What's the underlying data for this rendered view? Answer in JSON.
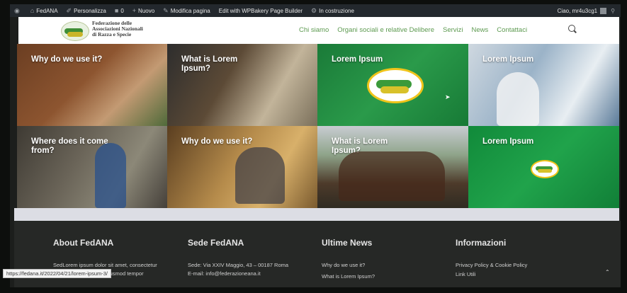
{
  "adminbar": {
    "items": [
      "FedANA",
      "Personalizza",
      "0",
      "Nuovo",
      "Modifica pagina",
      "Edit with WPBakery Page Builder",
      "In costruzione"
    ],
    "greeting": "Ciao, mr4u3cg1"
  },
  "header": {
    "org_line1": "Federazione delle",
    "org_line2": "Associazioni Nazionali",
    "org_line3": "di Razza e Specie",
    "nav": [
      "Chi siamo",
      "Organi sociali e relative Delibere",
      "Servizi",
      "News",
      "Contattaci"
    ]
  },
  "tiles": [
    {
      "title": "Why do we use it?"
    },
    {
      "title": "What is Lorem Ipsum?"
    },
    {
      "title": "Lorem Ipsum"
    },
    {
      "title": "Lorem Ipsum"
    },
    {
      "title": "Where does it come from?"
    },
    {
      "title": "Why do we use it?"
    },
    {
      "title": "What is Lorem Ipsum?"
    },
    {
      "title": "Lorem Ipsum"
    }
  ],
  "footer": {
    "about": {
      "title": "About FedANA",
      "text1": "SedLorem ipsum dolor sit amet, consectetur",
      "text2": "adipiscing elit, sed do eiusmod tempor"
    },
    "sede": {
      "title": "Sede FedANA",
      "address": "Sede: Via XXIV Maggio, 43 – 00187 Roma",
      "email": "E-mail: info@federazioneana.it"
    },
    "news": {
      "title": "Ultime News",
      "item1": "Why do we use it?",
      "item2": "What is Lorem Ipsum?"
    },
    "info": {
      "title": "Informazioni",
      "item1": "Privacy Policy & Cookie Policy",
      "item2": "Link Utili"
    }
  },
  "status_url": "https://fedana.it/2022/04/21/lorem-ipsum-3/",
  "colors": {
    "nav": "#5d9a50",
    "adminbar": "#23282d",
    "green_tile": "#1a8a3c"
  }
}
